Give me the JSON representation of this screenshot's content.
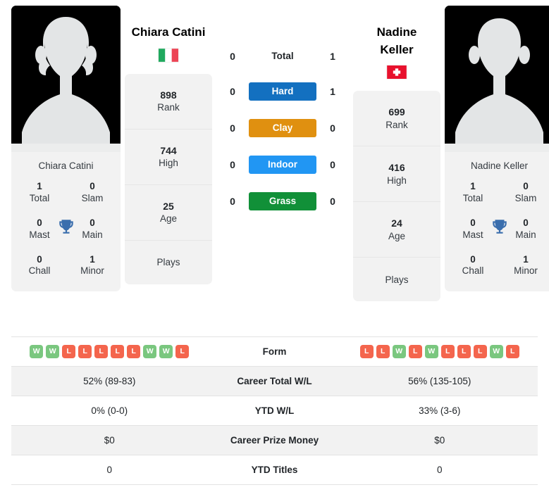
{
  "players": {
    "left": {
      "name": "Chiara Catini",
      "name_lines": [
        "Chiara Catini"
      ],
      "flag": "italy",
      "flag_name": "italy-flag-icon",
      "rank": "898",
      "rank_label": "Rank",
      "high": "744",
      "high_label": "High",
      "age": "25",
      "age_label": "Age",
      "plays_label": "Plays",
      "titles": {
        "total": "1",
        "total_label": "Total",
        "slam": "0",
        "slam_label": "Slam",
        "mast": "0",
        "mast_label": "Mast",
        "main": "0",
        "main_label": "Main",
        "chall": "0",
        "chall_label": "Chall",
        "minor": "1",
        "minor_label": "Minor"
      },
      "form": [
        "W",
        "W",
        "L",
        "L",
        "L",
        "L",
        "L",
        "W",
        "W",
        "L"
      ],
      "career_total_wl": "52% (89-83)",
      "ytd_wl": "0% (0-0)",
      "career_prize_money": "$0",
      "ytd_titles": "0"
    },
    "right": {
      "name": "Nadine Keller",
      "name_lines": [
        "Nadine",
        "Keller"
      ],
      "flag": "switzerland",
      "flag_name": "switzerland-flag-icon",
      "rank": "699",
      "rank_label": "Rank",
      "high": "416",
      "high_label": "High",
      "age": "24",
      "age_label": "Age",
      "plays_label": "Plays",
      "titles": {
        "total": "1",
        "total_label": "Total",
        "slam": "0",
        "slam_label": "Slam",
        "mast": "0",
        "mast_label": "Mast",
        "main": "0",
        "main_label": "Main",
        "chall": "0",
        "chall_label": "Chall",
        "minor": "1",
        "minor_label": "Minor"
      },
      "form": [
        "L",
        "L",
        "W",
        "L",
        "W",
        "L",
        "L",
        "L",
        "W",
        "L"
      ],
      "career_total_wl": "56% (135-105)",
      "ytd_wl": "33% (3-6)",
      "career_prize_money": "$0",
      "ytd_titles": "0"
    }
  },
  "head_to_head": [
    {
      "label": "Total",
      "left": "0",
      "right": "1",
      "style": "plain",
      "color": ""
    },
    {
      "label": "Hard",
      "left": "0",
      "right": "1",
      "style": "badge",
      "color": "#1370c0"
    },
    {
      "label": "Clay",
      "left": "0",
      "right": "0",
      "style": "badge",
      "color": "#e09010"
    },
    {
      "label": "Indoor",
      "left": "0",
      "right": "0",
      "style": "badge",
      "color": "#2196f3"
    },
    {
      "label": "Grass",
      "left": "0",
      "right": "0",
      "style": "badge",
      "color": "#119038"
    }
  ],
  "stats_rows": [
    {
      "label": "Form",
      "left_type": "form",
      "right_type": "form"
    },
    {
      "label": "Career Total W/L",
      "left": "52% (89-83)",
      "right": "56% (135-105)"
    },
    {
      "label": "YTD W/L",
      "left": "0% (0-0)",
      "right": "33% (3-6)"
    },
    {
      "label": "Career Prize Money",
      "left": "$0",
      "right": "$0"
    },
    {
      "label": "YTD Titles",
      "left": "0",
      "right": "0"
    }
  ],
  "colors": {
    "hard": "#1370c0",
    "clay": "#e09010",
    "indoor": "#2196f3",
    "grass": "#119038",
    "win": "#7ac77f",
    "loss": "#f4654d",
    "card_bg": "#f2f2f2",
    "trophy": "#3a6ead"
  },
  "icons": {
    "trophy": "trophy-icon",
    "avatar": "player-silhouette-avatar"
  }
}
